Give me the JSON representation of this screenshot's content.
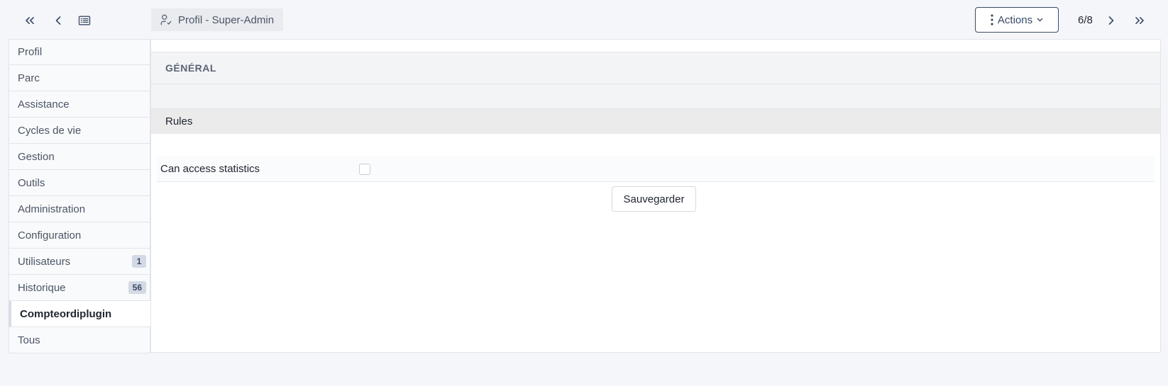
{
  "toolbar": {
    "breadcrumb_label": "Profil - Super-Admin",
    "actions_label": "Actions",
    "pager": "6/8"
  },
  "icons": {
    "first": "chevrons-left-icon",
    "prev": "chevron-left-icon",
    "list": "list-icon",
    "profile": "user-check-icon",
    "actions": "dots-vertical-icon",
    "caret": "chevron-down-icon",
    "next": "chevron-right-icon",
    "last": "chevrons-right-icon"
  },
  "sidebar": {
    "items": [
      {
        "label": "Profil"
      },
      {
        "label": "Parc"
      },
      {
        "label": "Assistance"
      },
      {
        "label": "Cycles de vie"
      },
      {
        "label": "Gestion"
      },
      {
        "label": "Outils"
      },
      {
        "label": "Administration"
      },
      {
        "label": "Configuration"
      },
      {
        "label": "Utilisateurs",
        "badge": "1"
      },
      {
        "label": "Historique",
        "badge": "56"
      },
      {
        "label": "Compteordiplugin",
        "active": true
      },
      {
        "label": "Tous"
      }
    ]
  },
  "main": {
    "section_title": "GÉNÉRAL",
    "rules_title": "Rules",
    "rights": [
      {
        "label": "Can access statistics",
        "checked": false
      }
    ],
    "save_label": "Sauvegarder"
  },
  "colors": {
    "accent": "#3b4b66",
    "background": "#f5f6fa",
    "badge": "#d4d9e6"
  }
}
